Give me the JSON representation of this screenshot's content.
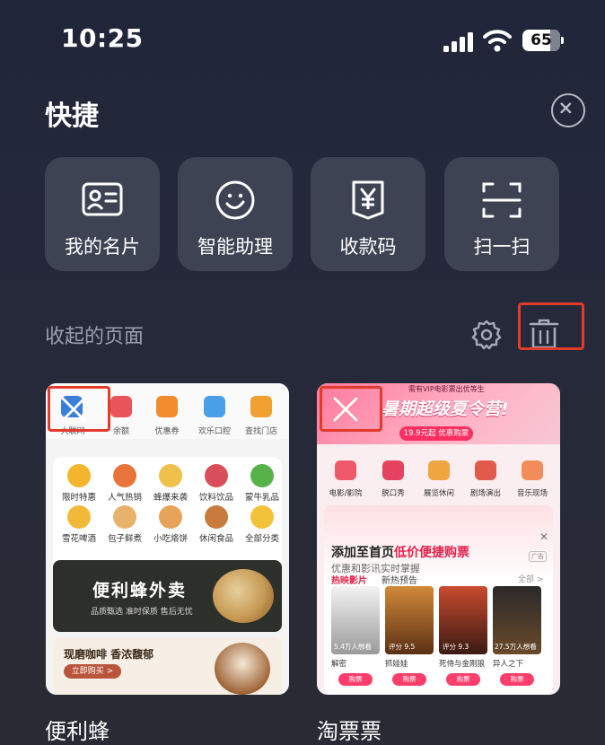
{
  "status_bar": {
    "time": "10:25",
    "battery": "65"
  },
  "header": {
    "title": "快捷"
  },
  "quick_actions": [
    {
      "label": "我的名片",
      "icon": "id-card-icon"
    },
    {
      "label": "智能助理",
      "icon": "smiley-icon"
    },
    {
      "label": "收款码",
      "icon": "yuan-receipt-icon"
    },
    {
      "label": "扫一扫",
      "icon": "scan-icon"
    }
  ],
  "collapsed_section": {
    "title": "收起的页面"
  },
  "highlight_color": "#e23b2b",
  "cards": [
    {
      "name": "便利蜂",
      "preview": {
        "top_row": [
          "大联网",
          "余额",
          "优惠券",
          "欢乐口腔",
          "查找门店"
        ],
        "grid": [
          [
            "限时特惠",
            "人气热销",
            "蜂爆来袭",
            "饮料饮品",
            "蒙牛乳品"
          ],
          [
            "雪花啤酒",
            "包子鲜煮",
            "小吃烙饼",
            "休闲食品",
            "全部分类"
          ]
        ],
        "banner1": {
          "title": "便利蜂外卖",
          "subtitle": "品质甄选  准时保质  售后无忧"
        },
        "banner2": {
          "title": "现磨咖啡 香浓馥郁",
          "button": "立即购买 >"
        }
      }
    },
    {
      "name": "淘票票",
      "preview": {
        "promo_small": "需有VIP电影票出优等生",
        "promo_title": "暑期超级夏令营!",
        "promo_button": "19.9元起 优惠购票",
        "icons": [
          "电影/影院",
          "脱口秀",
          "展览休闲",
          "剧场演出",
          "音乐现场"
        ],
        "add_title_prefix": "添加至首页",
        "add_title_accent": "低价便捷购票",
        "add_subtitle": "优惠和影讯实时掌握",
        "ad_tag": "广告",
        "tabs": [
          "热映影片",
          "新热预告"
        ],
        "all_link": "全部 >",
        "movies": [
          {
            "name": "解密",
            "info": "5.4万人想看",
            "buy": "购票"
          },
          {
            "name": "抓娃娃",
            "info": "评分 9.5",
            "buy": "购票"
          },
          {
            "name": "死侍与金刚狼",
            "info": "评分 9.3",
            "buy": "购票"
          },
          {
            "name": "异人之下",
            "info": "27.5万人想看",
            "buy": "购票"
          }
        ]
      }
    }
  ]
}
